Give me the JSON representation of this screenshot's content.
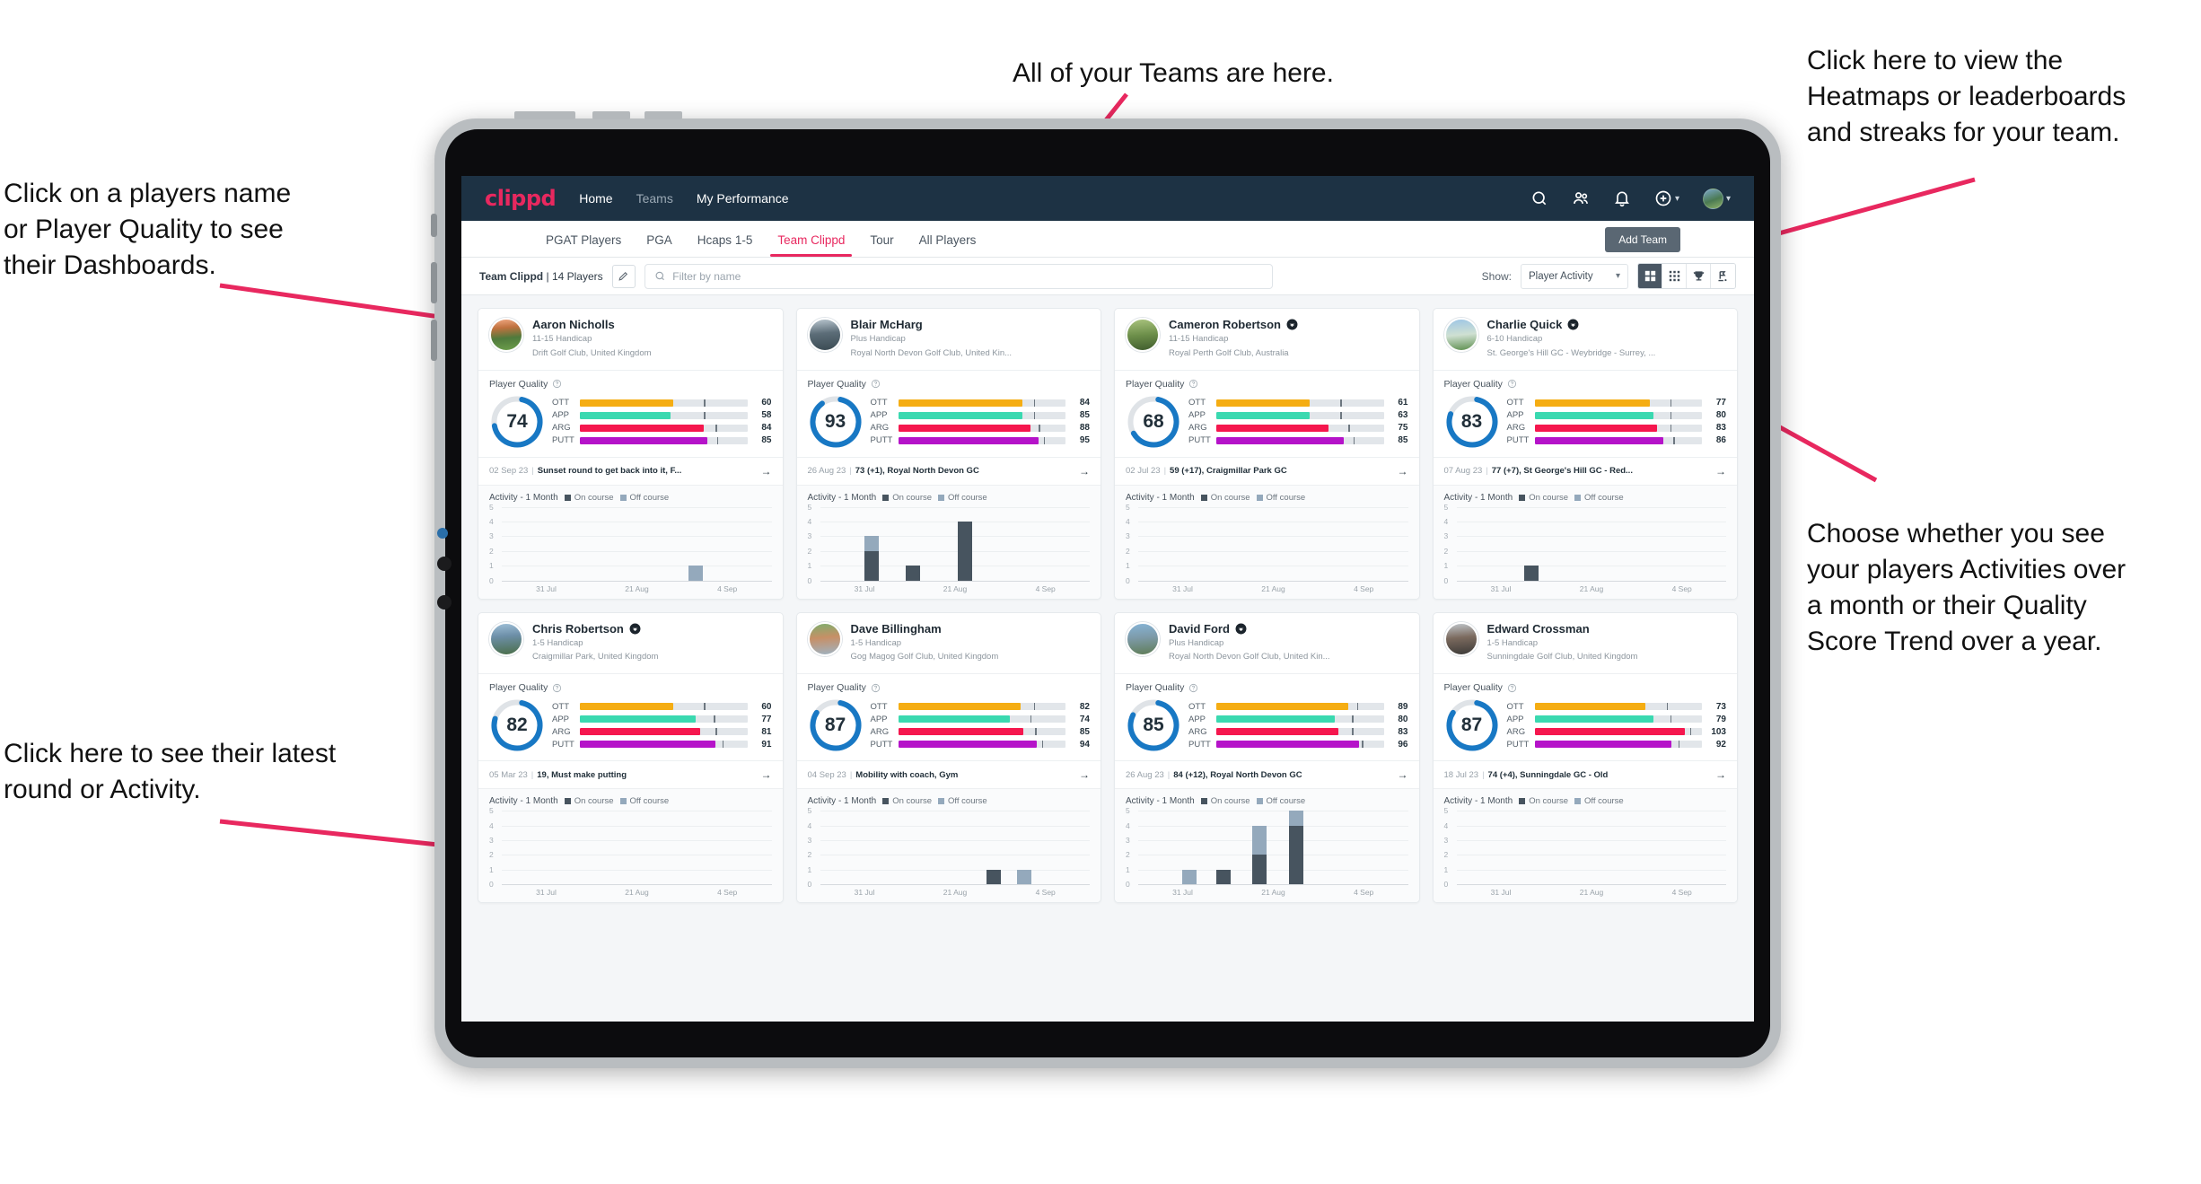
{
  "annotations": {
    "teams": "All of your Teams are here.",
    "heatmaps": "Click here to view the\nHeatmaps or leaderboards\nand streaks for your team.",
    "names": "Click on a players name\nor Player Quality to see\ntheir Dashboards.",
    "choose": "Choose whether you see\nyour players Activities over\na month or their Quality\nScore Trend over a year.",
    "latest": "Click here to see their latest\nround or Activity."
  },
  "topnav": {
    "brand": "clippd",
    "links": [
      {
        "label": "Home",
        "dim": false
      },
      {
        "label": "Teams",
        "dim": true
      },
      {
        "label": "My Performance",
        "dim": false
      }
    ],
    "icons": [
      "search-icon",
      "people-icon",
      "bell-icon",
      "plus-circle-icon",
      "avatar"
    ]
  },
  "subtabs": {
    "items": [
      {
        "label": "PGAT Players",
        "active": false
      },
      {
        "label": "PGA",
        "active": false
      },
      {
        "label": "Hcaps 1-5",
        "active": false
      },
      {
        "label": "Team Clippd",
        "active": true
      },
      {
        "label": "Tour",
        "active": false
      },
      {
        "label": "All Players",
        "active": false
      }
    ],
    "add_team_label": "Add Team"
  },
  "toolbar": {
    "team_name": "Team Clippd",
    "team_count": "14 Players",
    "separator": "|",
    "edit_icon": "pencil-icon",
    "search_placeholder": "Filter by name",
    "search_value": "",
    "show_label": "Show:",
    "show_value": "Player Activity",
    "view_modes": [
      {
        "name": "grid-view-icon",
        "active": true
      },
      {
        "name": "dense-grid-view-icon",
        "active": false
      },
      {
        "name": "trophy-leaderboard-icon",
        "active": false
      },
      {
        "name": "streaks-icon",
        "active": false
      }
    ]
  },
  "card_labels": {
    "player_quality": "Player Quality",
    "activity": "Activity - 1 Month",
    "legend_on": "On course",
    "legend_off": "Off course",
    "x_ticks": [
      "31 Jul",
      "21 Aug",
      "4 Sep"
    ],
    "y_ticks": [
      "5",
      "4",
      "3",
      "2",
      "1",
      "0"
    ]
  },
  "colors": {
    "brand": "#e8285f",
    "navbar": "#1d3244",
    "ring": "#1878c4",
    "ring_track": "#dfe3e7",
    "ott": "#f5ad13",
    "app": "#3ad9b0",
    "arg": "#f5174e",
    "putt": "#b513c9",
    "on_course": "#47545f",
    "off_course": "#94a9bc"
  },
  "players": [
    {
      "name": "Aaron Nicholls",
      "verified": false,
      "handicap": "11-15 Handicap",
      "club": "Drift Golf Club, United Kingdom",
      "avatar_class": "av0",
      "quality": 74,
      "ring_pct": 74,
      "metrics": [
        {
          "label": "OTT",
          "value": 60,
          "fill": 56,
          "tick": 74
        },
        {
          "label": "APP",
          "value": 58,
          "fill": 54,
          "tick": 74
        },
        {
          "label": "ARG",
          "value": 84,
          "fill": 74,
          "tick": 81
        },
        {
          "label": "PUTT",
          "value": 85,
          "fill": 76,
          "tick": 82
        }
      ],
      "round_date": "02 Sep 23",
      "round_text": "Sunset round to get back into it, F...",
      "chart_data": {
        "type": "bar",
        "stacked": true,
        "title": "Activity - 1 Month",
        "categories": [
          "31 Jul",
          "21 Aug",
          "4 Sep"
        ],
        "ylim": [
          0,
          5
        ],
        "grid": true,
        "legend": [
          "On course",
          "Off course"
        ],
        "bins": [
          {
            "pos": 0.72,
            "on": 0,
            "off": 1
          }
        ]
      }
    },
    {
      "name": "Blair McHarg",
      "verified": false,
      "handicap": "Plus Handicap",
      "club": "Royal North Devon Golf Club, United Kin...",
      "avatar_class": "av1",
      "quality": 93,
      "ring_pct": 93,
      "metrics": [
        {
          "label": "OTT",
          "value": 84,
          "fill": 74,
          "tick": 81
        },
        {
          "label": "APP",
          "value": 85,
          "fill": 74,
          "tick": 81
        },
        {
          "label": "ARG",
          "value": 88,
          "fill": 79,
          "tick": 84
        },
        {
          "label": "PUTT",
          "value": 95,
          "fill": 84,
          "tick": 87
        }
      ],
      "round_date": "26 Aug 23",
      "round_text": "73 (+1), Royal North Devon GC",
      "chart_data": {
        "type": "bar",
        "stacked": true,
        "title": "Activity - 1 Month",
        "categories": [
          "31 Jul",
          "21 Aug",
          "4 Sep"
        ],
        "ylim": [
          0,
          5
        ],
        "grid": true,
        "legend": [
          "On course",
          "Off course"
        ],
        "bins": [
          {
            "pos": 0.17,
            "on": 2,
            "off": 1
          },
          {
            "pos": 0.33,
            "on": 1,
            "off": 0
          },
          {
            "pos": 0.53,
            "on": 4,
            "off": 0
          }
        ]
      }
    },
    {
      "name": "Cameron Robertson",
      "verified": true,
      "handicap": "11-15 Handicap",
      "club": "Royal Perth Golf Club, Australia",
      "avatar_class": "av2",
      "quality": 68,
      "ring_pct": 68,
      "metrics": [
        {
          "label": "OTT",
          "value": 61,
          "fill": 56,
          "tick": 74
        },
        {
          "label": "APP",
          "value": 63,
          "fill": 56,
          "tick": 74
        },
        {
          "label": "ARG",
          "value": 75,
          "fill": 67,
          "tick": 79
        },
        {
          "label": "PUTT",
          "value": 85,
          "fill": 76,
          "tick": 82
        }
      ],
      "round_date": "02 Jul 23",
      "round_text": "59 (+17), Craigmillar Park GC",
      "chart_data": {
        "type": "bar",
        "stacked": true,
        "title": "Activity - 1 Month",
        "categories": [
          "31 Jul",
          "21 Aug",
          "4 Sep"
        ],
        "ylim": [
          0,
          5
        ],
        "grid": true,
        "legend": [
          "On course",
          "Off course"
        ],
        "bins": []
      }
    },
    {
      "name": "Charlie Quick",
      "verified": true,
      "handicap": "6-10 Handicap",
      "club": "St. George's Hill GC - Weybridge - Surrey, ...",
      "avatar_class": "av3",
      "quality": 83,
      "ring_pct": 83,
      "metrics": [
        {
          "label": "OTT",
          "value": 77,
          "fill": 69,
          "tick": 81
        },
        {
          "label": "APP",
          "value": 80,
          "fill": 71,
          "tick": 81
        },
        {
          "label": "ARG",
          "value": 83,
          "fill": 73,
          "tick": 81
        },
        {
          "label": "PUTT",
          "value": 86,
          "fill": 77,
          "tick": 83
        }
      ],
      "round_date": "07 Aug 23",
      "round_text": "77 (+7), St George's Hill GC - Red...",
      "chart_data": {
        "type": "bar",
        "stacked": true,
        "title": "Activity - 1 Month",
        "categories": [
          "31 Jul",
          "21 Aug",
          "4 Sep"
        ],
        "ylim": [
          0,
          5
        ],
        "grid": true,
        "legend": [
          "On course",
          "Off course"
        ],
        "bins": [
          {
            "pos": 0.26,
            "on": 1,
            "off": 0
          }
        ]
      }
    },
    {
      "name": "Chris Robertson",
      "verified": true,
      "handicap": "1-5 Handicap",
      "club": "Craigmillar Park, United Kingdom",
      "avatar_class": "av4",
      "quality": 82,
      "ring_pct": 82,
      "metrics": [
        {
          "label": "OTT",
          "value": 60,
          "fill": 56,
          "tick": 74
        },
        {
          "label": "APP",
          "value": 77,
          "fill": 69,
          "tick": 80
        },
        {
          "label": "ARG",
          "value": 81,
          "fill": 72,
          "tick": 81
        },
        {
          "label": "PUTT",
          "value": 91,
          "fill": 81,
          "tick": 85
        }
      ],
      "round_date": "05 Mar 23",
      "round_text": "19, Must make putting",
      "chart_data": {
        "type": "bar",
        "stacked": true,
        "title": "Activity - 1 Month",
        "categories": [
          "31 Jul",
          "21 Aug",
          "4 Sep"
        ],
        "ylim": [
          0,
          5
        ],
        "grid": true,
        "legend": [
          "On course",
          "Off course"
        ],
        "bins": []
      }
    },
    {
      "name": "Dave Billingham",
      "verified": false,
      "handicap": "1-5 Handicap",
      "club": "Gog Magog Golf Club, United Kingdom",
      "avatar_class": "av5",
      "quality": 87,
      "ring_pct": 87,
      "metrics": [
        {
          "label": "OTT",
          "value": 82,
          "fill": 73,
          "tick": 81
        },
        {
          "label": "APP",
          "value": 74,
          "fill": 67,
          "tick": 79
        },
        {
          "label": "ARG",
          "value": 85,
          "fill": 75,
          "tick": 82
        },
        {
          "label": "PUTT",
          "value": 94,
          "fill": 83,
          "tick": 86
        }
      ],
      "round_date": "04 Sep 23",
      "round_text": "Mobility with coach, Gym",
      "chart_data": {
        "type": "bar",
        "stacked": true,
        "title": "Activity - 1 Month",
        "categories": [
          "31 Jul",
          "21 Aug",
          "4 Sep"
        ],
        "ylim": [
          0,
          5
        ],
        "grid": true,
        "legend": [
          "On course",
          "Off course"
        ],
        "bins": [
          {
            "pos": 0.64,
            "on": 1,
            "off": 0
          },
          {
            "pos": 0.76,
            "on": 0,
            "off": 1
          }
        ]
      }
    },
    {
      "name": "David Ford",
      "verified": true,
      "handicap": "Plus Handicap",
      "club": "Royal North Devon Golf Club, United Kin...",
      "avatar_class": "av6",
      "quality": 85,
      "ring_pct": 85,
      "metrics": [
        {
          "label": "OTT",
          "value": 89,
          "fill": 79,
          "tick": 84
        },
        {
          "label": "APP",
          "value": 80,
          "fill": 71,
          "tick": 81
        },
        {
          "label": "ARG",
          "value": 83,
          "fill": 73,
          "tick": 81
        },
        {
          "label": "PUTT",
          "value": 96,
          "fill": 85,
          "tick": 87
        }
      ],
      "round_date": "26 Aug 23",
      "round_text": "84 (+12), Royal North Devon GC",
      "chart_data": {
        "type": "bar",
        "stacked": true,
        "title": "Activity - 1 Month",
        "categories": [
          "31 Jul",
          "21 Aug",
          "4 Sep"
        ],
        "ylim": [
          0,
          5
        ],
        "grid": true,
        "legend": [
          "On course",
          "Off course"
        ],
        "bins": [
          {
            "pos": 0.17,
            "on": 0,
            "off": 1
          },
          {
            "pos": 0.3,
            "on": 1,
            "off": 0
          },
          {
            "pos": 0.44,
            "on": 2,
            "off": 2
          },
          {
            "pos": 0.58,
            "on": 4,
            "off": 1
          }
        ]
      }
    },
    {
      "name": "Edward Crossman",
      "verified": false,
      "handicap": "1-5 Handicap",
      "club": "Sunningdale Golf Club, United Kingdom",
      "avatar_class": "av7",
      "quality": 87,
      "ring_pct": 87,
      "metrics": [
        {
          "label": "OTT",
          "value": 73,
          "fill": 66,
          "tick": 79
        },
        {
          "label": "APP",
          "value": 79,
          "fill": 71,
          "tick": 81
        },
        {
          "label": "ARG",
          "value": 103,
          "fill": 90,
          "tick": 93
        },
        {
          "label": "PUTT",
          "value": 92,
          "fill": 82,
          "tick": 86
        }
      ],
      "round_date": "18 Jul 23",
      "round_text": "74 (+4), Sunningdale GC - Old",
      "chart_data": {
        "type": "bar",
        "stacked": true,
        "title": "Activity - 1 Month",
        "categories": [
          "31 Jul",
          "21 Aug",
          "4 Sep"
        ],
        "ylim": [
          0,
          5
        ],
        "grid": true,
        "legend": [
          "On course",
          "Off course"
        ],
        "bins": []
      }
    }
  ]
}
